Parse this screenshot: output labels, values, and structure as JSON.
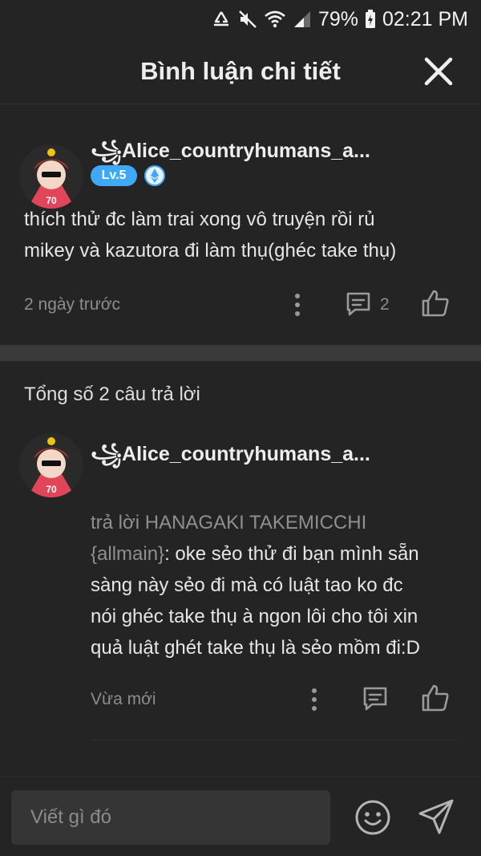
{
  "status_bar": {
    "battery": "79%",
    "time": "02:21 PM",
    "icons": [
      "recycle-data-icon",
      "mute-icon",
      "wifi-icon",
      "signal-icon",
      "battery-charging-icon"
    ]
  },
  "header": {
    "title": "Bình luận chi tiết",
    "close_icon": "close-icon"
  },
  "main_comment": {
    "username": "꧁Alice_countryhumans_a...",
    "level": "Lv.5",
    "badge_icon": "ethereum-badge-icon",
    "text_lines": [
      "thích thử đc làm trai xong vô truyện rồi rủ",
      "mikey và kazutora đi làm thụ(ghéc take thụ)"
    ],
    "time": "2 ngày trước",
    "reply_count": "2"
  },
  "replies_header": "Tổng số 2 câu trả lời",
  "reply": {
    "username": "꧁Alice_countryhumans_a...",
    "reply_prefix_1": "trả lời HANAGAKI TAKEMICCHI",
    "reply_prefix_2": "{allmain}",
    "text_first_tail": ": oke sẻo thử đi bạn mình sẵn",
    "text_lines": [
      "sàng này sẻo đi mà có luật tao ko đc",
      "nói ghéc take thụ à ngon lôi cho tôi xin",
      "quả luật ghét take thụ là sẻo mồm đi:D"
    ],
    "time": "Vừa mới"
  },
  "composer": {
    "placeholder": "Viết gì đó",
    "emoji_icon": "emoji-icon",
    "send_icon": "send-icon"
  },
  "colors": {
    "background": "#242424",
    "level_badge": "#3fa9f5",
    "muted_text": "#8d8d8d",
    "divider": "#3a3a3a"
  }
}
